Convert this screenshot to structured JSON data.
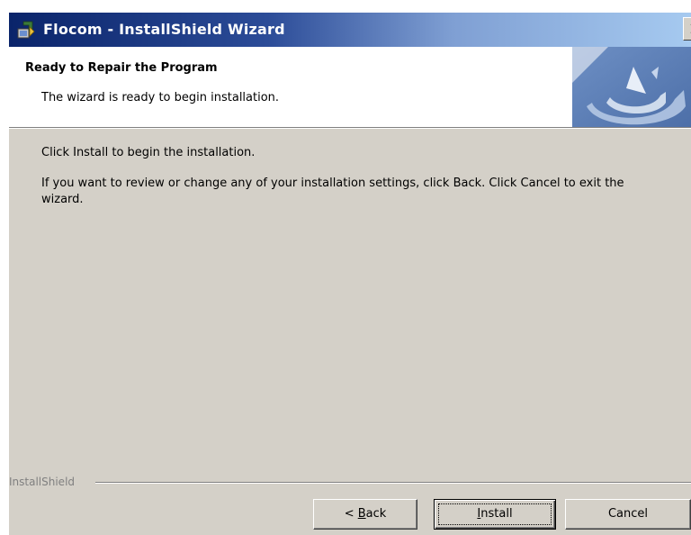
{
  "window": {
    "title": "Flocom - InstallShield Wizard",
    "close_glyph": "✕",
    "icon": "installer-icon"
  },
  "header": {
    "title": "Ready to Repair the Program",
    "subtitle": "The wizard is ready to begin installation.",
    "graphic": "installshield-logo-graphic"
  },
  "body": {
    "line1": "Click Install to begin the installation.",
    "line2": "If you want to review or change any of your installation settings, click Back. Click Cancel to exit the wizard."
  },
  "footer": {
    "brand": "InstallShield"
  },
  "buttons": {
    "back": {
      "prefix": "< ",
      "accel": "B",
      "rest": "ack"
    },
    "install": {
      "accel": "I",
      "rest": "nstall"
    },
    "cancel": {
      "label": "Cancel"
    }
  },
  "colors": {
    "title_gradient_start": "#0a246a",
    "title_gradient_end": "#a6caf0",
    "dialog_face": "#d4d0c8",
    "header_bg": "#ffffff",
    "logo_blue": "#5b7fb5"
  }
}
